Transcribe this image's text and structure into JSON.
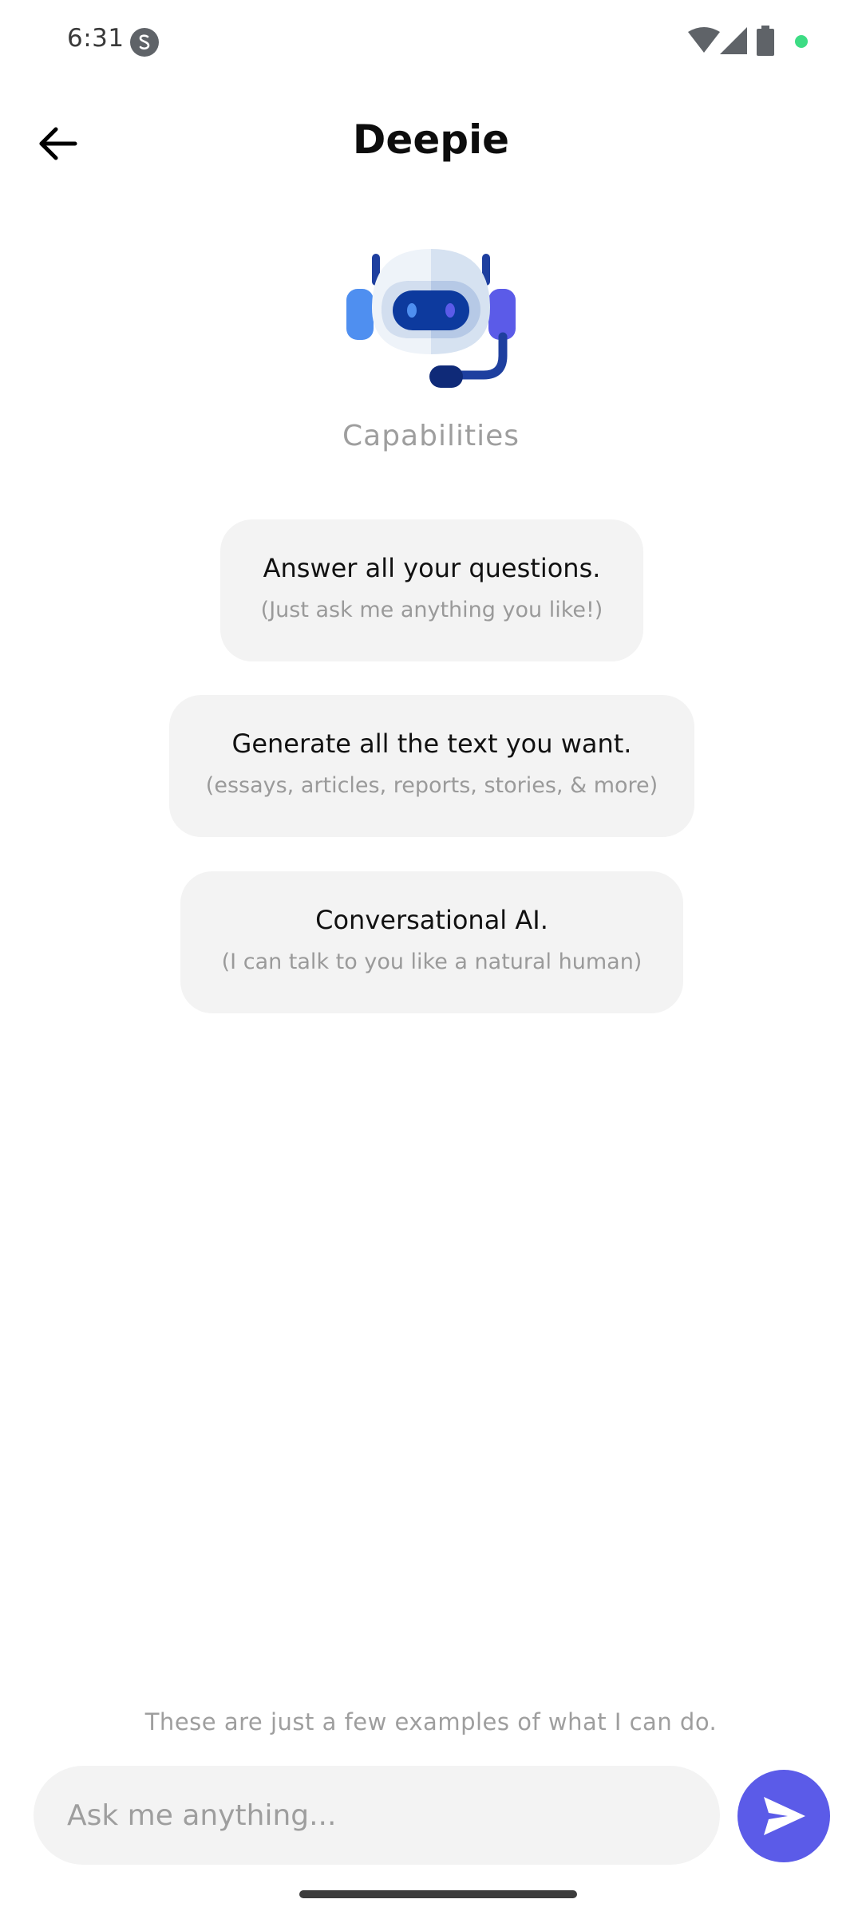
{
  "status_bar": {
    "time": "6:31"
  },
  "header": {
    "title": "Deepie"
  },
  "capabilities": {
    "title": "Capabilities",
    "items": [
      {
        "title": "Answer all your questions.",
        "subtitle": "(Just ask me anything you like!)"
      },
      {
        "title": "Generate all the text you want.",
        "subtitle": "(essays, articles, reports, stories, & more)"
      },
      {
        "title": "Conversational AI.",
        "subtitle": "(I can talk to you like a natural human)"
      }
    ]
  },
  "footer": {
    "hint": "These are just a few examples of what I can do.",
    "input_placeholder": "Ask me anything..."
  },
  "colors": {
    "accent": "#5b5be8",
    "card_bg": "#f3f3f3",
    "muted_text": "#9e9e9e"
  },
  "icons": {
    "back": "arrow-left-icon",
    "send": "send-icon",
    "robot": "robot-headset-icon"
  }
}
